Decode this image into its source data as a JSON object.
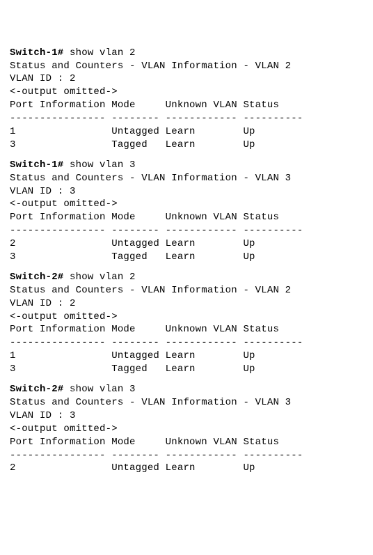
{
  "blocks": [
    {
      "prompt_host": "Switch-1#",
      "prompt_cmd": " show vlan 2",
      "title": "Status and Counters - VLAN Information - VLAN 2",
      "vlan_id_line": "VLAN ID : 2",
      "omitted": "<-output omitted->",
      "header": "Port Information Mode     Unknown VLAN Status",
      "divider": "---------------- -------- ------------ ----------",
      "rows": [
        "1                Untagged Learn        Up",
        "3                Tagged   Learn        Up"
      ]
    },
    {
      "prompt_host": "Switch-1#",
      "prompt_cmd": " show vlan 3",
      "title": "Status and Counters - VLAN Information - VLAN 3",
      "vlan_id_line": "VLAN ID : 3",
      "omitted": "<-output omitted->",
      "header": "Port Information Mode     Unknown VLAN Status",
      "divider": "---------------- -------- ------------ ----------",
      "rows": [
        "2                Untagged Learn        Up",
        "3                Tagged   Learn        Up"
      ]
    },
    {
      "prompt_host": "Switch-2#",
      "prompt_cmd": " show vlan 2",
      "title": "Status and Counters - VLAN Information - VLAN 2",
      "vlan_id_line": "VLAN ID : 2",
      "omitted": "<-output omitted->",
      "header": "Port Information Mode     Unknown VLAN Status",
      "divider": "---------------- -------- ------------ ----------",
      "rows": [
        "1                Untagged Learn        Up",
        "3                Tagged   Learn        Up"
      ]
    },
    {
      "prompt_host": "Switch-2#",
      "prompt_cmd": " show vlan 3",
      "title": "Status and Counters - VLAN Information - VLAN 3",
      "vlan_id_line": "VLAN ID : 3",
      "omitted": "<-output omitted->",
      "header": "Port Information Mode     Unknown VLAN Status",
      "divider": "---------------- -------- ------------ ----------",
      "rows": [
        "2                Untagged Learn        Up"
      ]
    }
  ]
}
